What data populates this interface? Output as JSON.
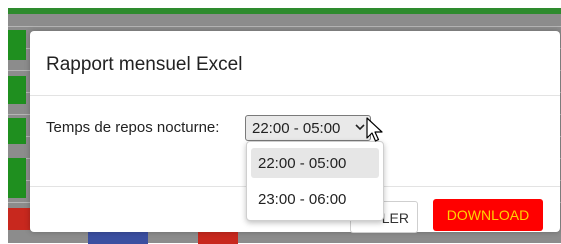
{
  "modal": {
    "title": "Rapport mensuel Excel",
    "field_label": "Temps de repos nocturne:",
    "select": {
      "value": "22:00 - 05:00",
      "options": [
        "22:00 - 05:00",
        "23:00 - 06:00"
      ],
      "selected_index": 0
    },
    "cancel_label": "LER",
    "download_label": "DOWNLOAD"
  },
  "icons": {
    "dropdown": "chevron-down-icon",
    "cursor": "mouse-pointer-icon"
  },
  "colors": {
    "download_bg": "#ff0000",
    "download_text": "#ffd400",
    "background_green": "#1f8f1f",
    "background_gray": "#8c8c8c"
  }
}
